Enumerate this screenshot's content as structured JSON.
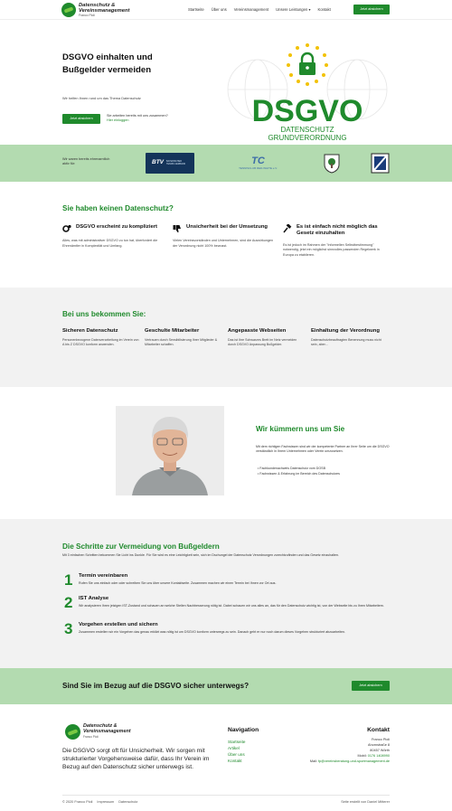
{
  "header": {
    "logo_line1": "Datenschutz &",
    "logo_line2": "Vereinsmanagement",
    "logo_sub": "Franco Pioli",
    "nav": [
      "Startseite",
      "Über uns",
      "Vereinsmanagement",
      "Unsere Leistungen ▾",
      "Kontakt"
    ],
    "cta": "Jetzt absichern"
  },
  "hero": {
    "title": "DSGVO einhalten und Bußgelder vermeiden",
    "subtitle": "Wir helfen Ihnen rund um das Thema Datenschutz",
    "button": "Jetzt absichern",
    "note_text": "Sie arbeiten bereits mit uns zusammen?",
    "note_link": "Hier einloggen",
    "badge_title": "DSGVO",
    "badge_line1": "DATENSCHUTZ",
    "badge_line2": "GRUNDVERORDNUNG"
  },
  "clients": {
    "label": "Wir waren bereits ehrenamtlich aktiv für:",
    "logo1": "BTV",
    "logo1_sub": "BAYERISCHER TENNIS-VERBAND",
    "logo2": "TC",
    "logo2_sub": "TENNISCLUB RED-WHITE e.V."
  },
  "problems": {
    "title": "Sie haben keinen Datenschutz?",
    "items": [
      {
        "icon": "gears-icon",
        "title": "DSGVO erscheint zu kompliziert",
        "text": "Alles, was mit administrativer DSGVO zu tun hat, überfordert die Ehrenämtler in Komplexität und Umfang."
      },
      {
        "icon": "thumbs-down-icon",
        "title": "Unsicherheit bei der Umsetzung",
        "text": "Vielen Vereinsvorständen und Unternehmen, sind die Auswirkungen der Verordnung nicht 100% bewusst."
      },
      {
        "icon": "gavel-icon",
        "title": "Es ist einfach nicht möglich das Gesetz einzuhalten",
        "text": "Es ist jedoch im Rahmen der \"Informellen Selbstbestimmung\" notwendig, jetzt ein möglichst sinnvolles passenden Regelwerk in Europa zu etablieren."
      }
    ]
  },
  "get": {
    "title": "Bei uns bekommen Sie:",
    "items": [
      {
        "title": "Sicheren Datenschutz",
        "text": "Personenbezogene Datenverarbeitung im Verein von A bis Z DSGVO konform anwenden."
      },
      {
        "title": "Geschulte Mitarbeiter",
        "text": "Vertrauen durch Sensibilisierung Ihrer Mitglieder & Mitarbeiter schaffen."
      },
      {
        "title": "Angepasste Webseiten",
        "text": "Das ist Ihre Schwarzes Brett im Netz vermeiden durch DSGVO Anpassung Bußgelder."
      },
      {
        "title": "Einhaltung der Verordnung",
        "text": "Datenschutzbeauftragten Benennung muss nicht sein, aber..."
      }
    ]
  },
  "care": {
    "title": "Wir kümmern uns um Sie",
    "text": "Mit dem richtigen Fachwissen sind wir der kompetente Partner an Ihrer Seite um die DSGVO verständlich in Ihrem Unternehmen oder Verein umzusetzen.",
    "list": [
      "Fachkundenachweis Datenschutz vom DOSB",
      "Fachwissen & Erfahrung im Bereich des Datenschutzes"
    ]
  },
  "steps": {
    "title": "Die Schritte zur Vermeidung von Bußgeldern",
    "intro": "Mit 3 einfachen Schritten bekommen Sie Licht ins Dunkle. Für Sie wird es eine Leichtigkeit sein, sich im Dschungel der Datenschutz Verordnungen zurechtzufinden und das Gesetz einzuhalten.",
    "items": [
      {
        "num": "1",
        "title": "Termin vereinbaren",
        "text": "Rufen Sie uns einfach oder oder schreiben Sie uns über unsere Kontaktseite. Zusammen machen wir einen Termin bei Ihnen vor Ort aus."
      },
      {
        "num": "2",
        "title": "IST Analyse",
        "text": "Wir analysieren Ihren jetzigen IST-Zustand und schauen an welche Stellen Nachbesserung nötig ist. Dabei schauen wir uns alles an, das für den Datenschutz wichtig ist, von der Webseite bis zu Ihren Mitarbeitern."
      },
      {
        "num": "3",
        "title": "Vorgehen erstellen und sichern",
        "text": "Zusammen erstellen wir ein Vorgehen das genau erklärt was nötig ist um DSGVO konform unterwegs zu sein. Danach geht er nur noch darum dieses Vorgehen strukturiert abzuarbeiten."
      }
    ]
  },
  "band": {
    "title": "Sind Sie im Bezug auf die DSGVO sicher unterwegs?",
    "button": "Jetzt absichern"
  },
  "footer": {
    "logo_line1": "Datenschutz &",
    "logo_line2": "Vereinsmanagement",
    "logo_sub": "Franco Pioli",
    "claim": "Die DSGVO sorgt oft für Unsicherheit. Wir sorgen mit strukturierter Vorgehensweise dafür, dass Ihr Verein im Bezug auf den Datenschutz sicher unterwegs ist.",
    "nav_title": "Navigation",
    "nav": [
      "Startseite",
      "Artikel",
      "Über uns",
      "Kontakt"
    ],
    "contact_title": "Kontakt",
    "contact_name": "Franco Pioli",
    "contact_street": "Ahornstraße 8",
    "contact_city": "80457 Wörth",
    "contact_mobil_label": "Mobil: ",
    "contact_mobil": "0176 1408990",
    "contact_mail_label": "Mail: ",
    "contact_mail": "fp@vereinsberatung-und-sportmanagement.de",
    "copyright": "© 2020 Franco Pioli",
    "impressum": "Impressum",
    "datenschutz": "Datenschutz",
    "credit": "Seite erstellt von Daniel Mitterer"
  },
  "colors": {
    "accent": "#1f8a2c",
    "band": "#b3dbb0",
    "light": "#f2f2f2"
  }
}
